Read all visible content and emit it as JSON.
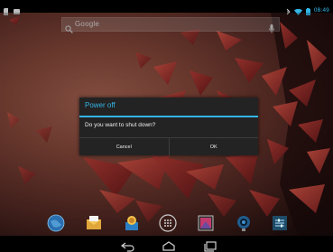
{
  "status_bar": {
    "time": "08:49",
    "icons": [
      "sd-card-icon",
      "usb-icon",
      "bluetooth-icon",
      "wifi-icon",
      "battery-icon"
    ]
  },
  "search": {
    "label": "Google",
    "icons": [
      "search-icon",
      "mic-icon"
    ]
  },
  "dialog": {
    "title": "Power off",
    "message": "Do you want to shut down?",
    "cancel_label": "Cancel",
    "ok_label": "OK"
  },
  "dock": {
    "icons": [
      "browser-icon",
      "email-icon",
      "file-manager-icon",
      "all-apps-icon",
      "gallery-icon",
      "camera-icon",
      "settings-icon"
    ]
  },
  "nav": {
    "buttons": [
      "back-icon",
      "home-icon",
      "recent-apps-icon"
    ]
  },
  "colors": {
    "accent": "#33b5e5",
    "dialog_bg": "#232323"
  }
}
